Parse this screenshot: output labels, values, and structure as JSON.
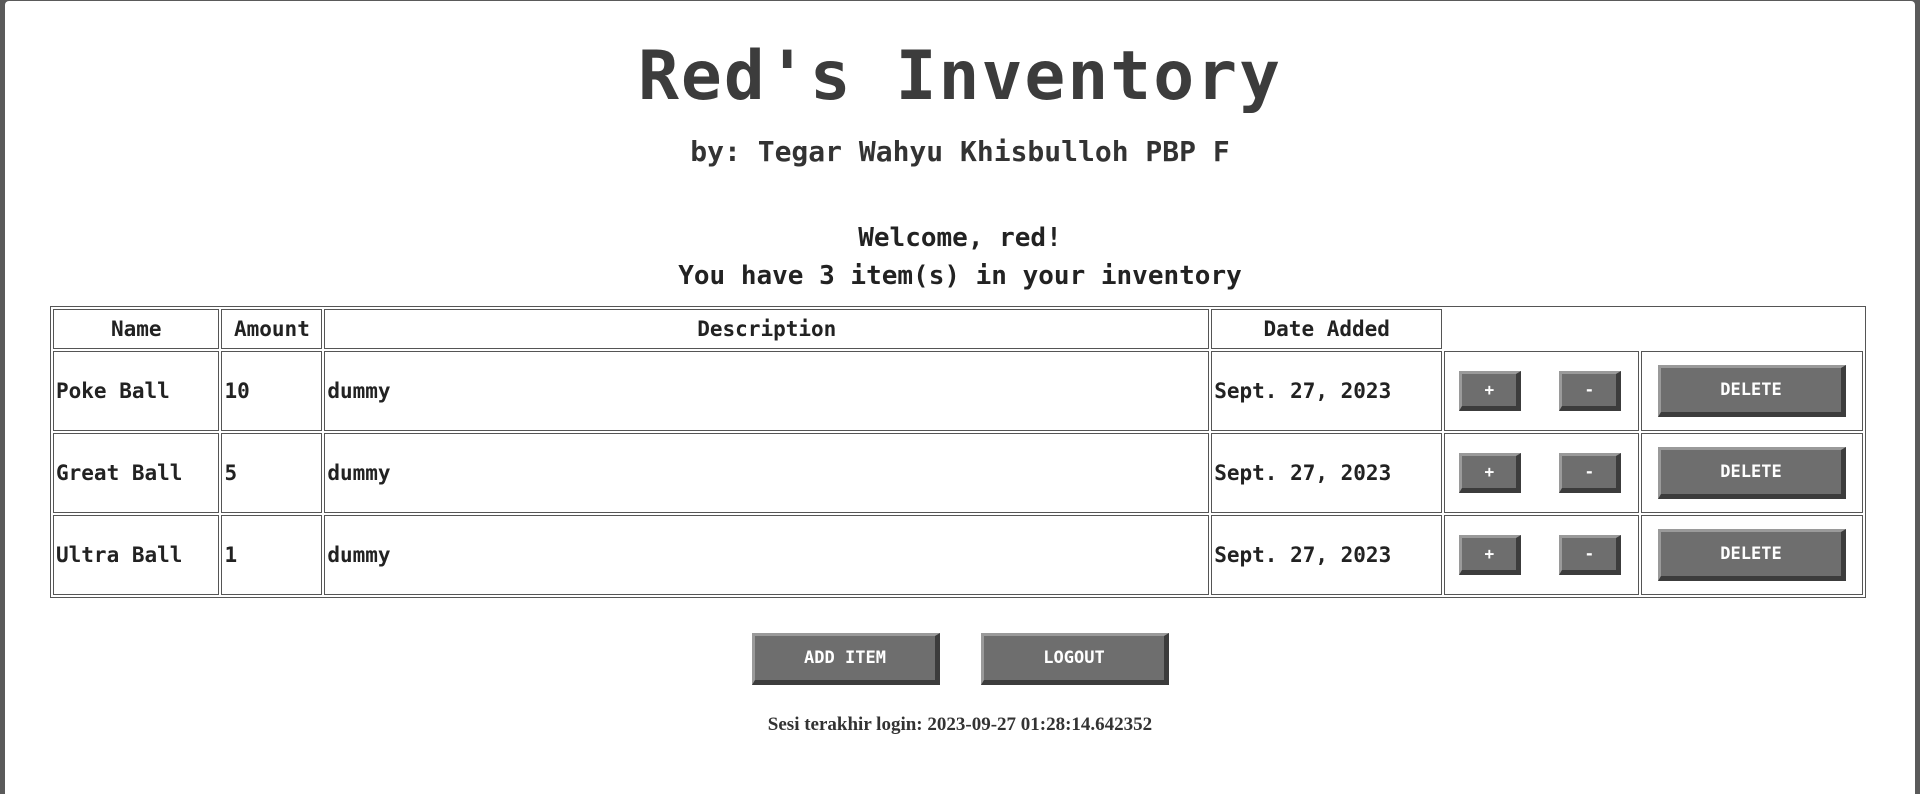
{
  "page": {
    "title": "Red's Inventory",
    "subtitle": "by: Tegar Wahyu Khisbulloh PBP F",
    "welcome": "Welcome, red!",
    "item_count_text": "You have 3 item(s) in your inventory"
  },
  "table": {
    "headers": [
      "Name",
      "Amount",
      "Description",
      "Date Added"
    ],
    "rows": [
      {
        "name": "Poke Ball",
        "amount": "10",
        "description": "dummy",
        "date_added": "Sept. 27, 2023"
      },
      {
        "name": "Great Ball",
        "amount": "5",
        "description": "dummy",
        "date_added": "Sept. 27, 2023"
      },
      {
        "name": "Ultra Ball",
        "amount": "1",
        "description": "dummy",
        "date_added": "Sept. 27, 2023"
      }
    ],
    "increment_label": "+",
    "decrement_label": "-",
    "delete_label": "DELETE"
  },
  "actions": {
    "add_item_label": "ADD ITEM",
    "logout_label": "LOGOUT"
  },
  "footer": {
    "last_login": "Sesi terakhir login: 2023-09-27 01:28:14.642352"
  },
  "colors": {
    "button_bg": "#6e6e6e",
    "text": "#333333",
    "background": "#ffffff"
  }
}
